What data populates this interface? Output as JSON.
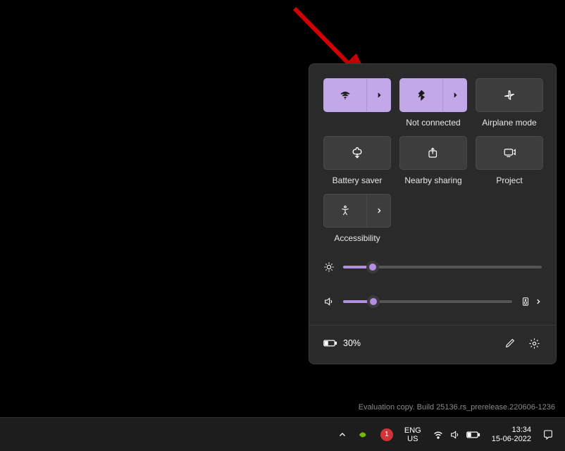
{
  "panel": {
    "tiles": [
      {
        "id": "wifi",
        "label": "",
        "active": true,
        "split": true,
        "icon": "wifi-icon"
      },
      {
        "id": "bluetooth",
        "label": "Not connected",
        "active": true,
        "split": true,
        "icon": "bluetooth-icon"
      },
      {
        "id": "airplane",
        "label": "Airplane mode",
        "active": false,
        "split": false,
        "icon": "airplane-icon"
      },
      {
        "id": "battery-saver",
        "label": "Battery saver",
        "active": false,
        "split": false,
        "icon": "battery-saver-icon"
      },
      {
        "id": "nearby",
        "label": "Nearby sharing",
        "active": false,
        "split": false,
        "icon": "share-icon"
      },
      {
        "id": "project",
        "label": "Project",
        "active": false,
        "split": false,
        "icon": "project-icon"
      },
      {
        "id": "accessibility",
        "label": "Accessibility",
        "active": false,
        "split": true,
        "icon": "accessibility-icon"
      }
    ],
    "brightness_percent": 15,
    "volume_percent": 18,
    "battery_label": "30%"
  },
  "watermark": "Evaluation copy. Build 25136.rs_prerelease.220606-1236",
  "taskbar": {
    "lang_top": "ENG",
    "lang_bottom": "US",
    "time": "13:34",
    "date": "15-06-2022",
    "notif_count": "1"
  }
}
